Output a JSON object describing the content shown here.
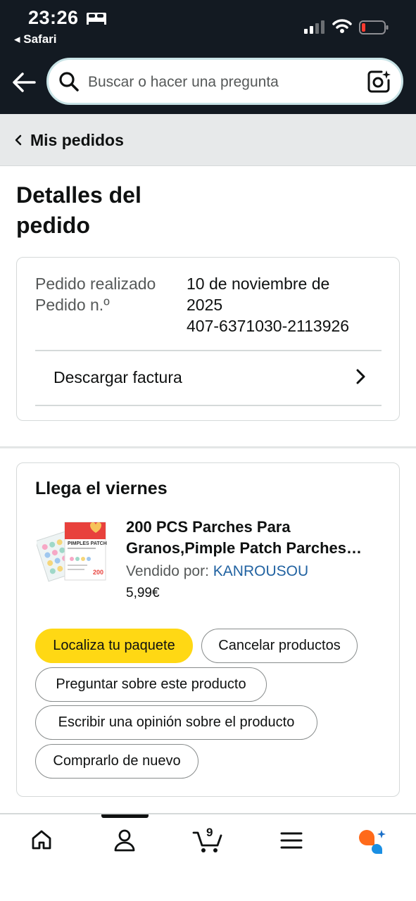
{
  "status_bar": {
    "time": "23:26",
    "back_app": "◂ Safari"
  },
  "search": {
    "placeholder": "Buscar o hacer una pregunta"
  },
  "breadcrumb": {
    "label": "Mis pedidos"
  },
  "page": {
    "title_line1": "Detalles del",
    "title_line2": "pedido"
  },
  "order": {
    "placed_label": "Pedido realizado",
    "number_label": "Pedido n.º",
    "date_line1": "10 de noviembre de",
    "date_line2": "2025",
    "number": "407-6371030-2113926",
    "invoice_label": "Descargar factura"
  },
  "shipment": {
    "heading": "Llega el viernes",
    "product_title_line1": "200 PCS Parches Para",
    "product_title_line2": "Granos,Pimple Patch Parches…",
    "sold_by_label": "Vendido por:",
    "seller": "KANROUSOU",
    "price": "5,99€",
    "product_image_text": "PIMPLES PATCH",
    "product_image_count": "200"
  },
  "actions": {
    "track": "Localiza tu paquete",
    "cancel": "Cancelar productos",
    "ask": "Preguntar sobre este producto",
    "review": "Escribir una opinión sobre el producto",
    "buy_again": "Comprarlo de nuevo"
  },
  "bottom_nav": {
    "cart_count": "9",
    "active_tab": "account"
  },
  "colors": {
    "header_bg": "#131a22",
    "primary_button": "#ffd814",
    "seller_link": "#2162a1",
    "battery_low": "#ff3b30"
  }
}
